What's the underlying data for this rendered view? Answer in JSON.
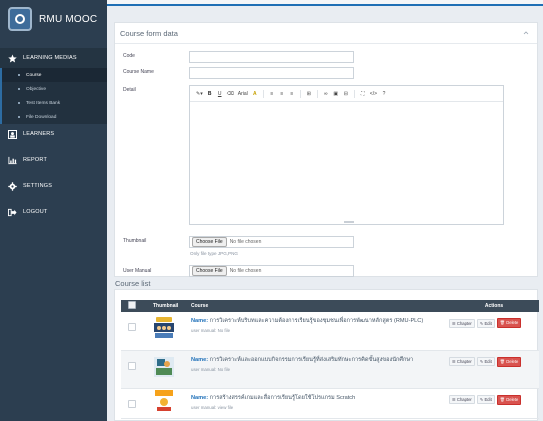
{
  "brand": {
    "name": "RMU MOOC"
  },
  "sidebar": {
    "learning_medias": "LEARNING MEDIAS",
    "sub_items": [
      "Course",
      "Objective",
      "Test Items Bank",
      "File Download"
    ],
    "learners": "LEARNERS",
    "report": "REPORT",
    "settings": "SETTINGS",
    "logout": "LOGOUT"
  },
  "form": {
    "title": "Course form data",
    "code_label": "Code",
    "course_name_label": "Course Name",
    "detail_label": "Detail",
    "thumbnail_label": "Thumbnail",
    "user_manual_label": "User Manual",
    "choose_file": "Choose File",
    "no_file": "No file chosen",
    "file_hint": "Only file type JPG,PNG",
    "toolbar": [
      "B",
      "U",
      "Arial",
      "A",
      "≡",
      "≡",
      "≡",
      "⊞",
      "∞",
      "▣",
      "⊟",
      "⛶",
      "</>",
      "?"
    ]
  },
  "list": {
    "title": "Course list",
    "col_thumbnail": "Thumbnail",
    "col_course": "Course",
    "col_actions": "Actions",
    "name_prefix": "Name:",
    "btn_chapter": "Chapter",
    "btn_edit": "Edit",
    "btn_delete": "Delete",
    "rows": [
      {
        "name": "การวิเคราะห์บริบทและความต้องการเรียนรู้ของชุมชนเพื่อการพัฒนาหลักสูตร (RMU-PLC)",
        "manual": "user manual: No file",
        "thumb_label": "RMU-PLC"
      },
      {
        "name": "การวิเคราะห์และออกแบบกิจกรรมการเรียนรู้ที่ส่งเสริมทักษะการคิดขั้นสูงของนักศึกษา",
        "manual": "user manual: No file",
        "thumb_label": ""
      },
      {
        "name": "การสร้างสรรค์เกมและสื่อการเรียนรู้โดยใช้โปรแกรม Scratch",
        "manual": "user manual: view file",
        "thumb_label": "Scratch"
      }
    ]
  },
  "colors": {
    "sidebar": "#2c3e50",
    "accent": "#1f6fb5",
    "delete": "#d9534f",
    "table_head": "#3c4b59"
  }
}
